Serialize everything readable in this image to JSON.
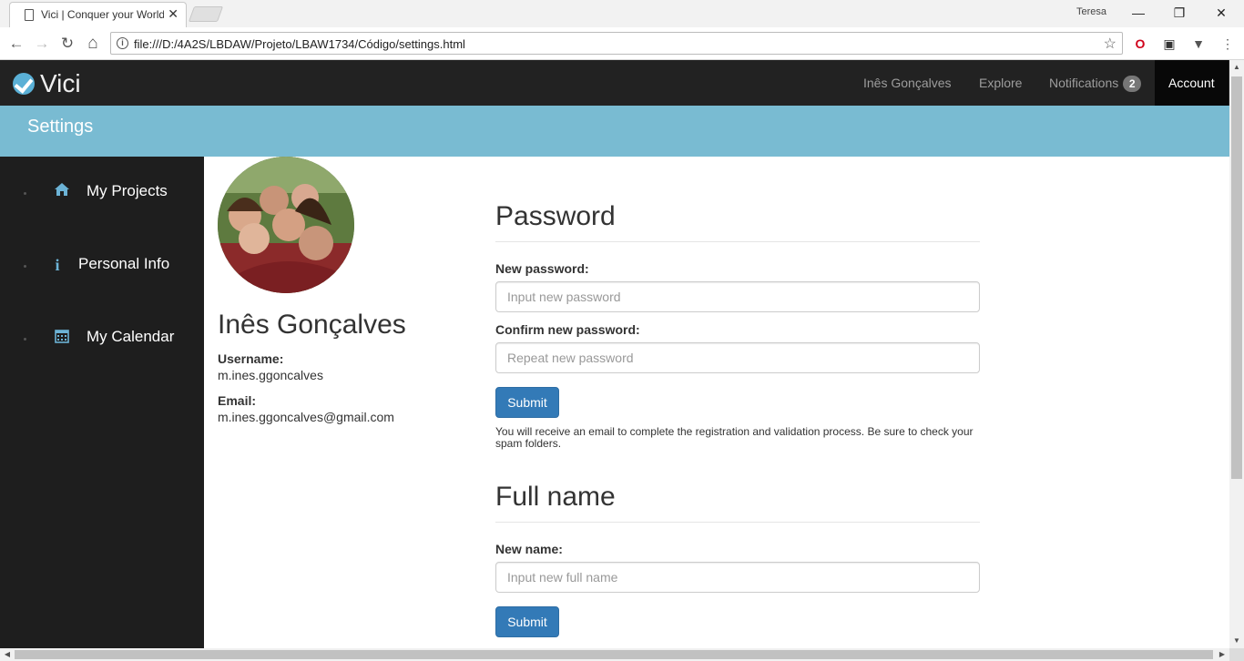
{
  "browser": {
    "tab_title": "Vici | Conquer your World",
    "tab_close": "✕",
    "profile": "Teresa",
    "url": "file:///D:/4A2S/LBDAW/Projeto/LBAW1734/Código/settings.html",
    "window_controls": {
      "minimize": "—",
      "restore": "❐",
      "close": "✕"
    },
    "nav": {
      "back": "←",
      "forward": "→",
      "reload": "↻",
      "home": "⌂"
    },
    "star": "☆",
    "info": "i"
  },
  "navbar": {
    "brand": "Vici",
    "links": [
      {
        "label": "Inês Gonçalves"
      },
      {
        "label": "Explore"
      },
      {
        "label": "Notifications",
        "badge": "2"
      },
      {
        "label": "Account"
      }
    ]
  },
  "banner": {
    "title": "Settings"
  },
  "sidebar": {
    "items": [
      {
        "label": "My Projects",
        "icon": "home-icon"
      },
      {
        "label": "Personal Info",
        "icon": "info-icon"
      },
      {
        "label": "My Calendar",
        "icon": "calendar-icon"
      }
    ]
  },
  "profile": {
    "name": "Inês Gonçalves",
    "username_label": "Username:",
    "username": "m.ines.ggoncalves",
    "email_label": "Email:",
    "email": "m.ines.ggoncalves@gmail.com"
  },
  "password_section": {
    "title": "Password",
    "new_label": "New password:",
    "new_placeholder": "Input new password",
    "confirm_label": "Confirm new password:",
    "confirm_placeholder": "Repeat new password",
    "submit": "Submit",
    "help": "You will receive an email to complete the registration and validation process. Be sure to check your spam folders."
  },
  "name_section": {
    "title": "Full name",
    "new_label": "New name:",
    "new_placeholder": "Input new full name",
    "submit": "Submit"
  },
  "colors": {
    "navbar": "#222222",
    "banner": "#79bbd2",
    "sidebar": "#1e1e1e",
    "primary_button": "#337ab7",
    "sidebar_icon": "#6cb3d6"
  }
}
